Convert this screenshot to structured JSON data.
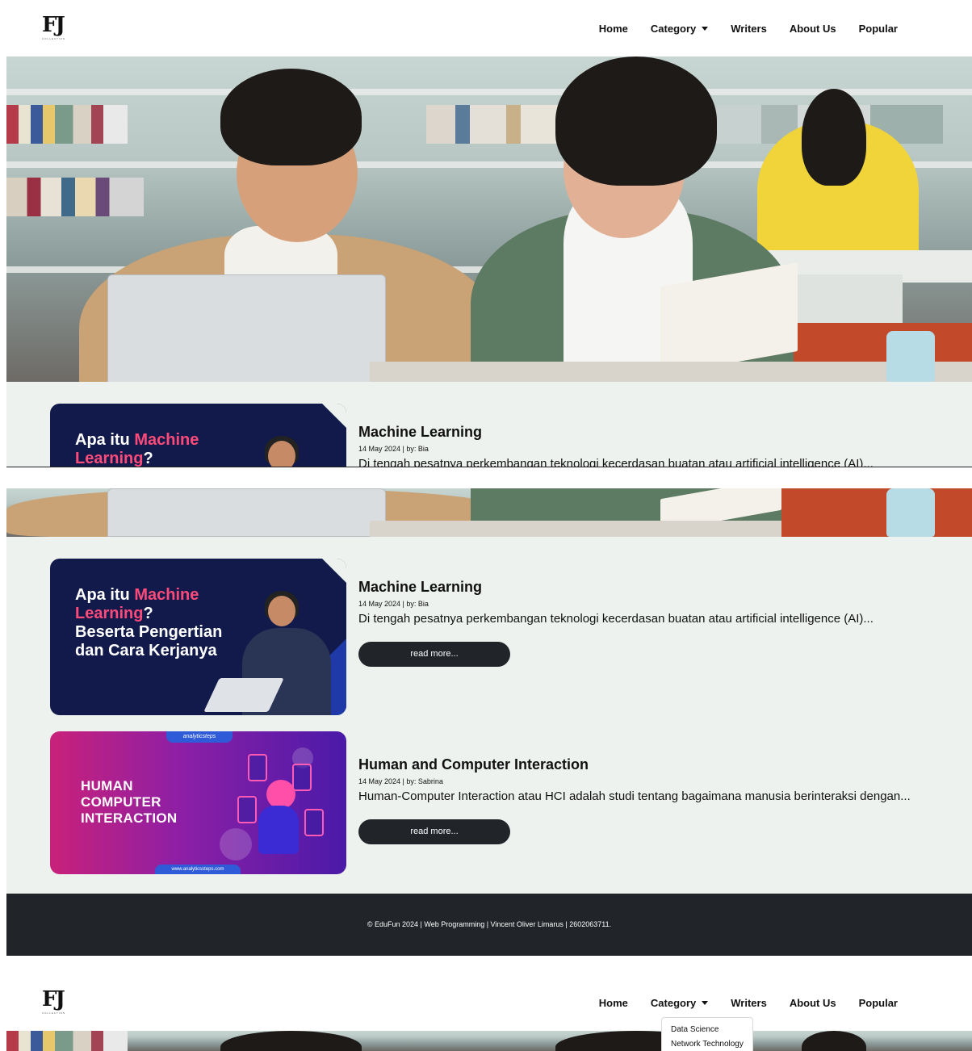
{
  "brand": {
    "logo_mark": "FJ",
    "logo_sub": "COLLECTION"
  },
  "nav": {
    "home": "Home",
    "category": "Category",
    "writers": "Writers",
    "about": "About Us",
    "popular": "Popular"
  },
  "dropdown": {
    "items": [
      "Data Science",
      "Network Technology"
    ]
  },
  "articles": [
    {
      "thumb_line1": "Apa itu",
      "thumb_line1_accent": "Machine",
      "thumb_line2_accent": "Learning",
      "thumb_line2_rest": "?",
      "thumb_line3": "Beserta Pengertian",
      "thumb_line4": "dan Cara Kerjanya",
      "title": "Machine Learning",
      "meta": "14 May 2024 | by: Bia",
      "excerpt": "Di tengah pesatnya perkembangan teknologi kecerdasan buatan atau artificial intelligence (AI)...",
      "button": "read more..."
    },
    {
      "thumb_brand": "analyticsteps",
      "thumb_line1": "HUMAN",
      "thumb_line2": "COMPUTER",
      "thumb_line3": "INTERACTION",
      "thumb_url": "www.analyticssteps.com",
      "title": "Human and Computer Interaction",
      "meta": "14 May 2024 | by: Sabrina",
      "excerpt": "Human-Computer Interaction atau HCI adalah studi tentang bagaimana manusia berinteraksi dengan...",
      "button": "read more..."
    }
  ],
  "footer": {
    "text": "© EduFun 2024 | Web Programming | Vincent Oliver Limarus | 2602063711."
  }
}
